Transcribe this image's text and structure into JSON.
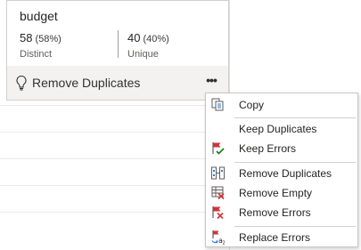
{
  "card": {
    "title": "budget",
    "distinct_count": "58",
    "distinct_pct": "(58%)",
    "distinct_label": "Distinct",
    "unique_count": "40",
    "unique_pct": "(40%)",
    "unique_label": "Unique",
    "footer_label": "Remove Duplicates",
    "footer_icon": "lightbulb-icon",
    "more_label": "•••"
  },
  "menu": {
    "items": [
      {
        "label": "Copy",
        "icon": "copy-icon"
      },
      {
        "label": "Keep Duplicates",
        "icon": ""
      },
      {
        "label": "Keep Errors",
        "icon": "keep-errors-icon"
      },
      {
        "label": "Remove Duplicates",
        "icon": "remove-duplicates-icon"
      },
      {
        "label": "Remove Empty",
        "icon": "remove-empty-icon"
      },
      {
        "label": "Remove Errors",
        "icon": "remove-errors-icon"
      },
      {
        "label": "Replace Errors",
        "icon": "replace-errors-icon"
      }
    ]
  },
  "colors": {
    "footer_bg": "#f3f2f1",
    "error_red": "#d13438",
    "check_green": "#107c10",
    "accent_blue": "#2b7cd3"
  }
}
